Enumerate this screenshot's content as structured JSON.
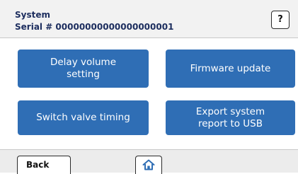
{
  "header": {
    "title": "System",
    "serial": "Serial # 00000000000000000001"
  },
  "help": {
    "label": "?"
  },
  "actions": {
    "delay_line1": "Delay volume",
    "delay_line2": "setting",
    "firmware": "Firmware update",
    "switch": "Switch valve timing",
    "export_line1": "Export system",
    "export_line2": "report to USB"
  },
  "footer": {
    "back": "Back",
    "home_icon": "home-icon"
  },
  "colors": {
    "accent": "#2f6eb5",
    "header_text": "#1c2d5e"
  }
}
